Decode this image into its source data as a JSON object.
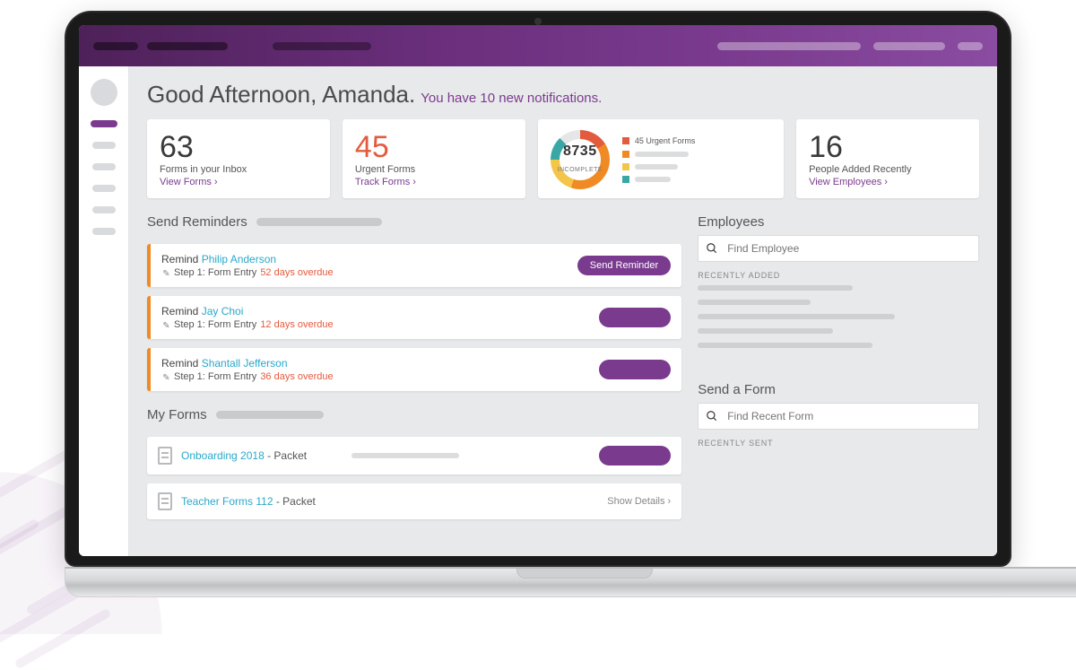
{
  "greeting": {
    "title": "Good Afternoon, Amanda.",
    "note": "You have 10 new notifications."
  },
  "stats": {
    "inbox": {
      "value": "63",
      "label": "Forms in your Inbox",
      "link": "View Forms ›"
    },
    "urgent": {
      "value": "45",
      "label": "Urgent Forms",
      "link": "Track Forms ›"
    },
    "donut": {
      "center_value": "8735",
      "center_label": "INCOMPLETE",
      "legend_first": "45 Urgent Forms",
      "colors": {
        "red": "#e35b3e",
        "orange": "#f08a24",
        "yellow": "#f3c64a",
        "teal": "#3aa7a7"
      }
    },
    "people": {
      "value": "16",
      "label": "People Added Recently",
      "link": "View Employees ›"
    }
  },
  "reminders": {
    "title": "Send Reminders",
    "items": [
      {
        "prefix": "Remind ",
        "who": "Philip Anderson",
        "step": "Step 1: Form Entry ",
        "due": "52 days overdue",
        "button": "Send Reminder"
      },
      {
        "prefix": "Remind ",
        "who": "Jay Choi",
        "step": "Step 1: Form Entry ",
        "due": "12 days overdue",
        "button": ""
      },
      {
        "prefix": "Remind ",
        "who": "Shantall Jefferson",
        "step": "Step 1: Form Entry ",
        "due": "36 days overdue",
        "button": ""
      }
    ]
  },
  "my_forms": {
    "title": "My Forms",
    "items": [
      {
        "name": "Onboarding 2018",
        "suffix": " - Packet",
        "detail": ""
      },
      {
        "name": "Teacher Forms 112",
        "suffix": " - Packet",
        "detail": "Show Details ›"
      }
    ]
  },
  "employees": {
    "title": "Employees",
    "search_placeholder": "Find Employee",
    "recently_added": "RECENTLY ADDED"
  },
  "send_form": {
    "title": "Send a Form",
    "search_placeholder": "Find Recent Form",
    "recently_sent": "RECENTLY SENT"
  }
}
